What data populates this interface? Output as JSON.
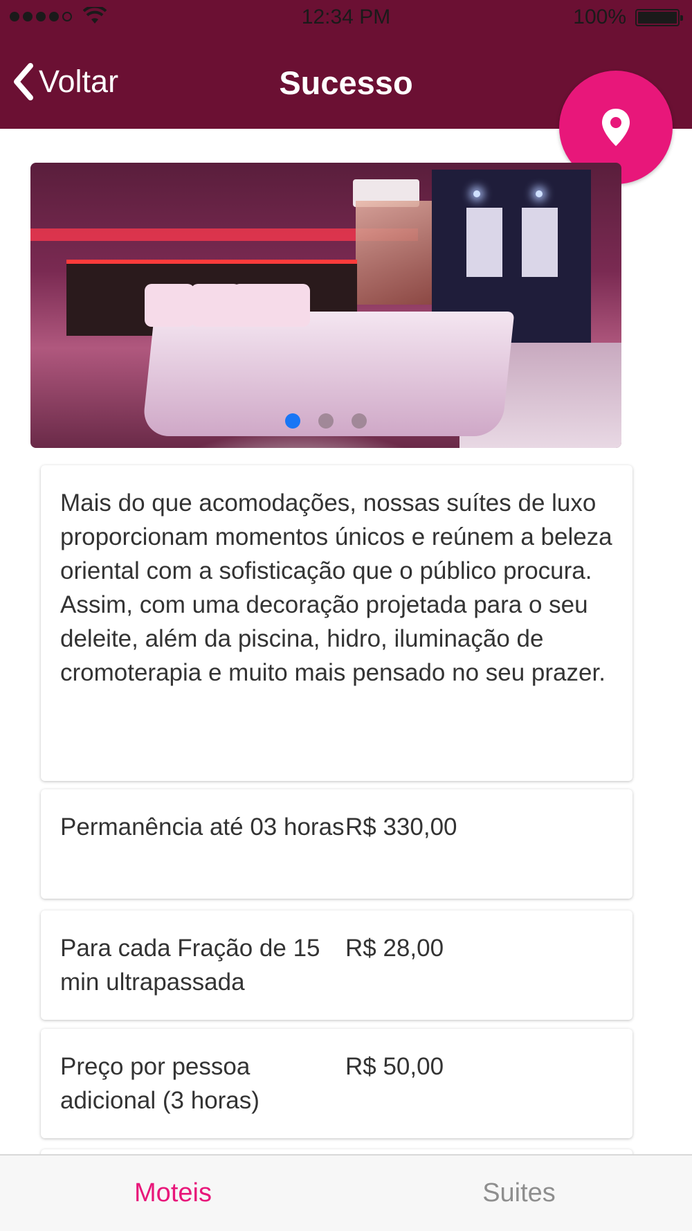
{
  "status_bar": {
    "time": "12:34 PM",
    "battery": "100%"
  },
  "header": {
    "back_label": "Voltar",
    "title": "Sucesso"
  },
  "carousel": {
    "slide_count": 3,
    "active_index": 0
  },
  "description": "Mais do que acomodações, nossas suítes de luxo proporcionam momentos únicos e reúnem a beleza oriental com a sofisticação que o público procura. Assim, com uma decoração projetada para o seu deleite, além da piscina, hidro, iluminação de cromoterapia e muito mais pensado no seu prazer.",
  "prices": [
    {
      "label": "Permanência até 03 horas",
      "value": "R$ 330,00"
    },
    {
      "label": "Para cada Fração de 15 min ultrapassada",
      "value": "R$ 28,00"
    },
    {
      "label": "Preço por pessoa adicional (3 horas)",
      "value": "R$ 50,00"
    }
  ],
  "tabs": [
    {
      "label": "Moteis",
      "active": true
    },
    {
      "label": "Suites",
      "active": false
    }
  ],
  "colors": {
    "header": "#6b1033",
    "accent": "#e8177a",
    "dot_active": "#1976f5",
    "tab_inactive": "#8e8e8e"
  },
  "icons": {
    "back": "chevron-left-icon",
    "map": "map-pin-icon",
    "wifi": "wifi-icon",
    "battery": "battery-icon"
  }
}
